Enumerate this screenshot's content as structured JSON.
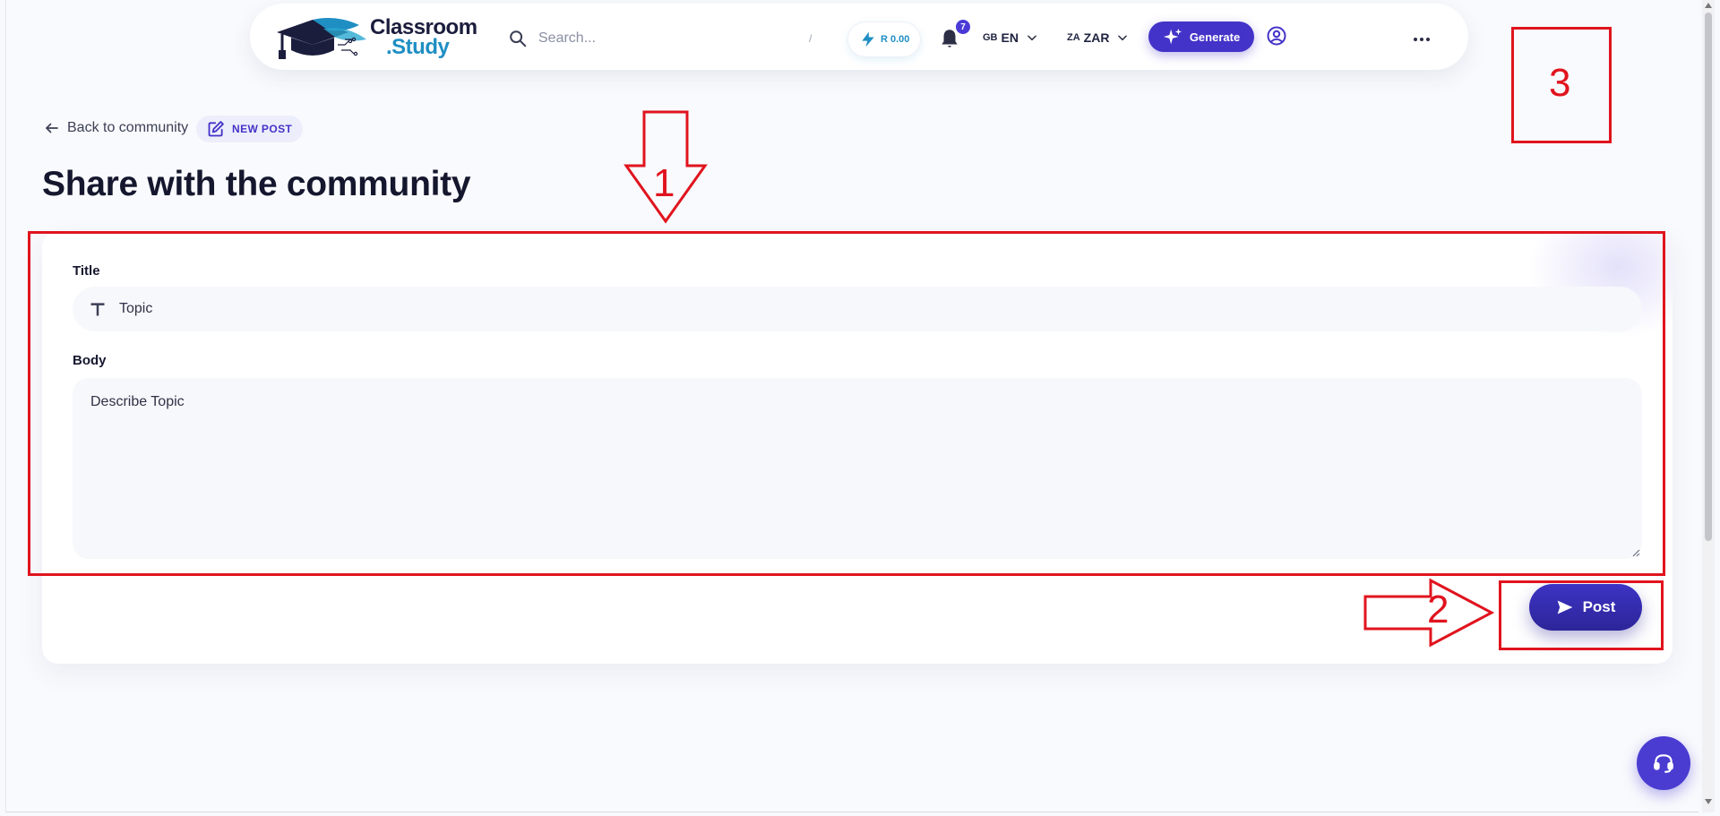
{
  "header": {
    "logo": {
      "line1": "Classroom",
      "line2": ".Study"
    },
    "search": {
      "placeholder": "Search...",
      "shortcut": "/"
    },
    "wallet": {
      "label": "R 0.00"
    },
    "notifications": {
      "count": "7"
    },
    "language": {
      "code": "GB",
      "label": "EN"
    },
    "currency": {
      "code": "ZA",
      "label": "ZAR"
    },
    "generate_label": "Generate"
  },
  "page": {
    "back_label": "Back to community",
    "badge_label": "NEW POST",
    "title": "Share with the community"
  },
  "form": {
    "title_label": "Title",
    "title_placeholder": "Topic",
    "body_label": "Body",
    "body_placeholder": "Describe Topic",
    "post_label": "Post"
  },
  "annotations": {
    "one": "1",
    "two": "2",
    "three": "3",
    "color": "#e0141e"
  },
  "colors": {
    "brand_primary": "#4433c8",
    "brand_accent": "#1f8ec3",
    "page_bg": "#f9fafd"
  },
  "icons": [
    "search-icon",
    "lightning-icon",
    "bell-icon",
    "chevron-down-icon",
    "sparkle-icon",
    "user-circle-icon",
    "more-icon",
    "arrow-left-icon",
    "edit-icon",
    "text-icon",
    "send-icon",
    "support-icon"
  ]
}
